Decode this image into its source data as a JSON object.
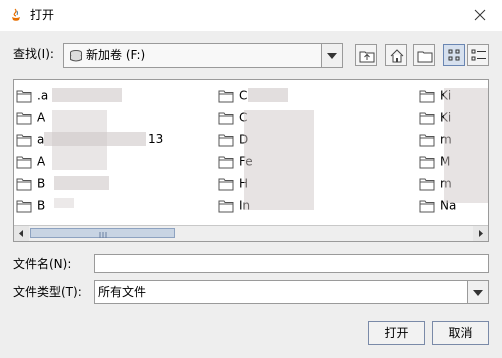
{
  "window": {
    "title": "打开"
  },
  "lookin": {
    "label": "查找(I):",
    "value": "新加卷 (F:)"
  },
  "toolbar": {
    "buttons": [
      {
        "name": "up-one-level-icon"
      },
      {
        "name": "home-icon"
      },
      {
        "name": "new-folder-icon"
      },
      {
        "name": "list-view-icon"
      },
      {
        "name": "details-view-icon"
      }
    ]
  },
  "files": {
    "column1": [
      ".a",
      "A",
      "a",
      "A",
      "B",
      "B"
    ],
    "column1_extra": "13",
    "column2": [
      "C",
      "C",
      "D",
      "Fe",
      "H",
      "In"
    ],
    "column3": [
      "Ki",
      "Ki",
      "m",
      "M",
      "m",
      "Na"
    ]
  },
  "filename": {
    "label": "文件名(N):",
    "value": ""
  },
  "filetype": {
    "label": "文件类型(T):",
    "value": "所有文件"
  },
  "buttons": {
    "open": "打开",
    "cancel": "取消"
  },
  "colors": {
    "window_bg": "#EEEEEE",
    "list_bg": "#FFFFFF",
    "folder_yellow": "#F5D78A",
    "active_toggle": "#D6E0EE"
  }
}
